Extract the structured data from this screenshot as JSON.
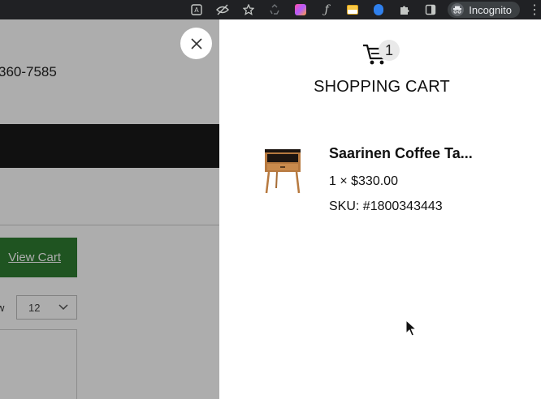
{
  "browser": {
    "incognito_label": "Incognito",
    "menu_glyph": "⋮",
    "extensions": [
      "translate-icon",
      "eye-off-icon",
      "star-icon",
      "recycle-icon",
      "colorful-extension-icon",
      "script-icon",
      "notes-extension-icon",
      "vpn-icon",
      "puzzle-icon",
      "sidepanel-icon"
    ]
  },
  "background_page": {
    "phone_text": "360-7585",
    "view_cart_label": "View Cart",
    "show_label": "w",
    "per_page_value": "12"
  },
  "cart": {
    "count": "1",
    "title": "SHOPPING CART",
    "items": [
      {
        "name": "Saarinen Coffee Ta...",
        "price_line": "1 × $330.00",
        "sku_line": "SKU: #1800343443"
      }
    ]
  },
  "colors": {
    "browser_bar": "#202124",
    "overlay": "rgba(0,0,0,0.32)",
    "view_cart_button": "#2e7d32",
    "navbar": "#1a1a1a"
  }
}
